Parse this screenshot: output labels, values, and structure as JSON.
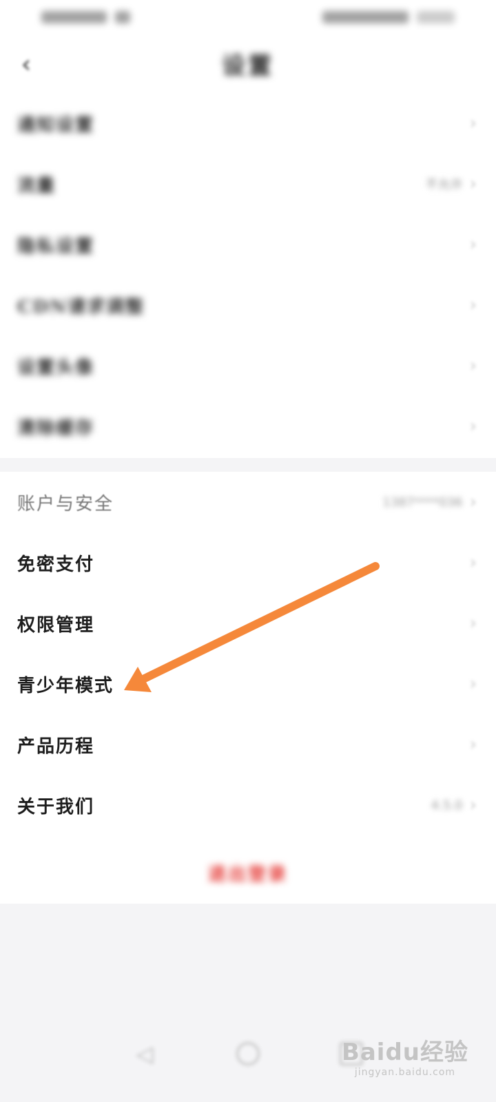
{
  "header": {
    "back_icon": "chevron-left-icon",
    "title": "设置"
  },
  "settings_top": [
    {
      "label": "通知设置",
      "value": "",
      "id": "notification-settings"
    },
    {
      "label": "流量",
      "value": "不允许",
      "id": "data-traffic"
    },
    {
      "label": "隐私设置",
      "value": "",
      "id": "privacy-settings"
    },
    {
      "label": "CDN请求调整",
      "value": "",
      "id": "cdn-settings"
    },
    {
      "label": "设置头像",
      "value": "",
      "id": "avatar-settings"
    },
    {
      "label": "清除缓存",
      "value": "",
      "id": "clear-cache"
    }
  ],
  "settings_bottom": [
    {
      "label": "账户与安全",
      "value": "1387****036",
      "id": "account-security"
    },
    {
      "label": "免密支付",
      "value": "",
      "id": "password-free-pay"
    },
    {
      "label": "权限管理",
      "value": "",
      "id": "permission-management"
    },
    {
      "label": "青少年模式",
      "value": "",
      "id": "teen-mode"
    },
    {
      "label": "产品历程",
      "value": "",
      "id": "product-history"
    },
    {
      "label": "关于我们",
      "value": "4.5.0",
      "id": "about-us"
    }
  ],
  "logout": {
    "label": "退出登录"
  },
  "annotation": {
    "color": "#f5883a",
    "target": "青少年模式"
  },
  "watermark": {
    "logo": "Baidu经验",
    "url": "jingyan.baidu.com"
  },
  "colors": {
    "background": "#ffffff",
    "band": "#f4f4f6",
    "logout": "#e53935",
    "chevron": "#c8c8c8"
  }
}
